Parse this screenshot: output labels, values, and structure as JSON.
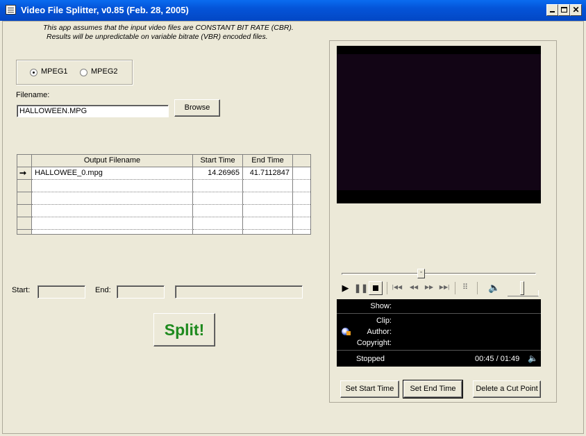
{
  "window": {
    "title": "Video File Splitter, v0.85 (Feb. 28, 2005)"
  },
  "notes": {
    "line1": "This app assumes that the input video files are CONSTANT BIT RATE (CBR).",
    "line2": "Results will be unpredictable on variable bitrate (VBR) encoded files."
  },
  "format": {
    "option1": "MPEG1",
    "option2": "MPEG2",
    "selected": "MPEG1"
  },
  "file": {
    "label": "Filename:",
    "value": "HALLOWEEN.MPG",
    "browse": "Browse"
  },
  "grid": {
    "columns": [
      "Output Filename",
      "Start Time",
      "End Time"
    ],
    "rows": [
      {
        "filename": "HALLOWEE_0.mpg",
        "start": "14.26965",
        "end": "41.7112847"
      }
    ]
  },
  "range": {
    "start_label": "Start:",
    "end_label": "End:"
  },
  "split_button": "Split!",
  "player": {
    "show_label": "Show:",
    "clip_label": "Clip:",
    "author_label": "Author:",
    "copyright_label": "Copyright:",
    "status": "Stopped",
    "time": "00:45 / 01:49",
    "seek_position": 0.41
  },
  "buttons": {
    "set_start": "Set Start Time",
    "set_end": "Set End Time",
    "delete_cut": "Delete a Cut Point"
  },
  "colors": {
    "split_text": "#1e8a1e",
    "title_bar": "#0454d8"
  }
}
